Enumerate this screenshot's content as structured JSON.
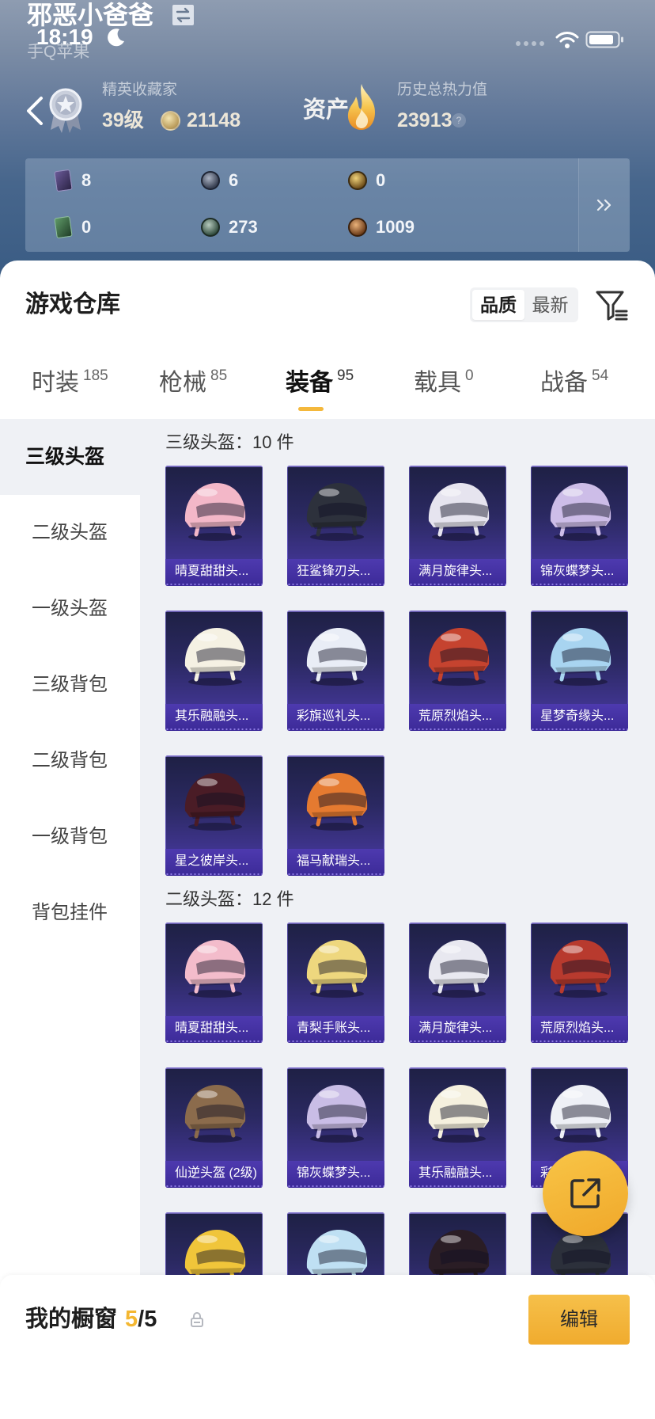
{
  "status_bar": {
    "time": "18:19"
  },
  "profile": {
    "nickname": "邪恶小爸爸",
    "platform": "手Q苹果",
    "rank_title": "精英收藏家",
    "level": "39级",
    "coins": "21148",
    "assets_label": "资产",
    "heat_label": "历史总热力值",
    "heat_value": "23913",
    "help": "?"
  },
  "stats": [
    {
      "icon": "purple-card-icon",
      "value": "8"
    },
    {
      "icon": "silver-coin-icon",
      "value": "6"
    },
    {
      "icon": "gold-coin-icon",
      "value": "0"
    },
    {
      "icon": "green-card-icon",
      "value": "0"
    },
    {
      "icon": "green-gem-icon",
      "value": "273"
    },
    {
      "icon": "bronze-coin-icon",
      "value": "1009"
    }
  ],
  "stats_more_icon": "double-chevron-right-icon",
  "warehouse": {
    "title": "游戏仓库",
    "sort_options": [
      {
        "label": "品质",
        "selected": true
      },
      {
        "label": "最新",
        "selected": false
      }
    ],
    "filter_icon": "filter-icon"
  },
  "tabs": [
    {
      "label": "时装",
      "count": "185",
      "active": false
    },
    {
      "label": "枪械",
      "count": "85",
      "active": false
    },
    {
      "label": "装备",
      "count": "95",
      "active": true
    },
    {
      "label": "载具",
      "count": "0",
      "active": false
    },
    {
      "label": "战备",
      "count": "54",
      "active": false
    }
  ],
  "sidebar": [
    {
      "label": "三级头盔",
      "selected": true
    },
    {
      "label": "二级头盔",
      "selected": false
    },
    {
      "label": "一级头盔",
      "selected": false
    },
    {
      "label": "三级背包",
      "selected": false
    },
    {
      "label": "二级背包",
      "selected": false
    },
    {
      "label": "一级背包",
      "selected": false
    },
    {
      "label": "背包挂件",
      "selected": false
    }
  ],
  "sections": [
    {
      "title": "三级头盔：10 件",
      "items": [
        {
          "name": "晴夏甜甜头...",
          "color": "#f3b7c8"
        },
        {
          "name": "狂鲨锋刃头...",
          "color": "#2d313c"
        },
        {
          "name": "满月旋律头...",
          "color": "#e6e4ef"
        },
        {
          "name": "锦灰蝶梦头...",
          "color": "#cdbde8"
        },
        {
          "name": "其乐融融头...",
          "color": "#f5f1e3"
        },
        {
          "name": "彩旗巡礼头...",
          "color": "#e9edf6"
        },
        {
          "name": "荒原烈焰头...",
          "color": "#c5432f"
        },
        {
          "name": "星梦奇缘头...",
          "color": "#a8d4f0"
        },
        {
          "name": "星之彼岸头...",
          "color": "#4a1c26"
        },
        {
          "name": "福马献瑞头...",
          "color": "#e57a30"
        }
      ]
    },
    {
      "title": "二级头盔：12 件",
      "items": [
        {
          "name": "晴夏甜甜头...",
          "color": "#f3bccb"
        },
        {
          "name": "青梨手账头...",
          "color": "#eed77e"
        },
        {
          "name": "满月旋律头...",
          "color": "#e8e8f0"
        },
        {
          "name": "荒原烈焰头...",
          "color": "#b83a2e"
        },
        {
          "name": "仙逆头盔 (2级)",
          "color": "#8b6b4c"
        },
        {
          "name": "锦灰蝶梦头...",
          "color": "#c9bde6"
        },
        {
          "name": "其乐融融头...",
          "color": "#f5f0de"
        },
        {
          "name": "彩",
          "color": "#eef0f6"
        },
        {
          "name": "",
          "color": "#f0c53a"
        },
        {
          "name": "",
          "color": "#bfe0f3"
        },
        {
          "name": "",
          "color": "#2a1d25"
        },
        {
          "name": "",
          "color": "#2c303b"
        }
      ]
    }
  ],
  "showcase": {
    "label": "我的橱窗",
    "count": "5",
    "total": "/5",
    "edit_label": "编辑"
  },
  "colors": {
    "accent": "#f4b83c",
    "showcase_count": "#f4b731",
    "card_top": "#1e2044",
    "card_bottom": "#4b3ba8",
    "content_bg": "#eff1f5"
  }
}
